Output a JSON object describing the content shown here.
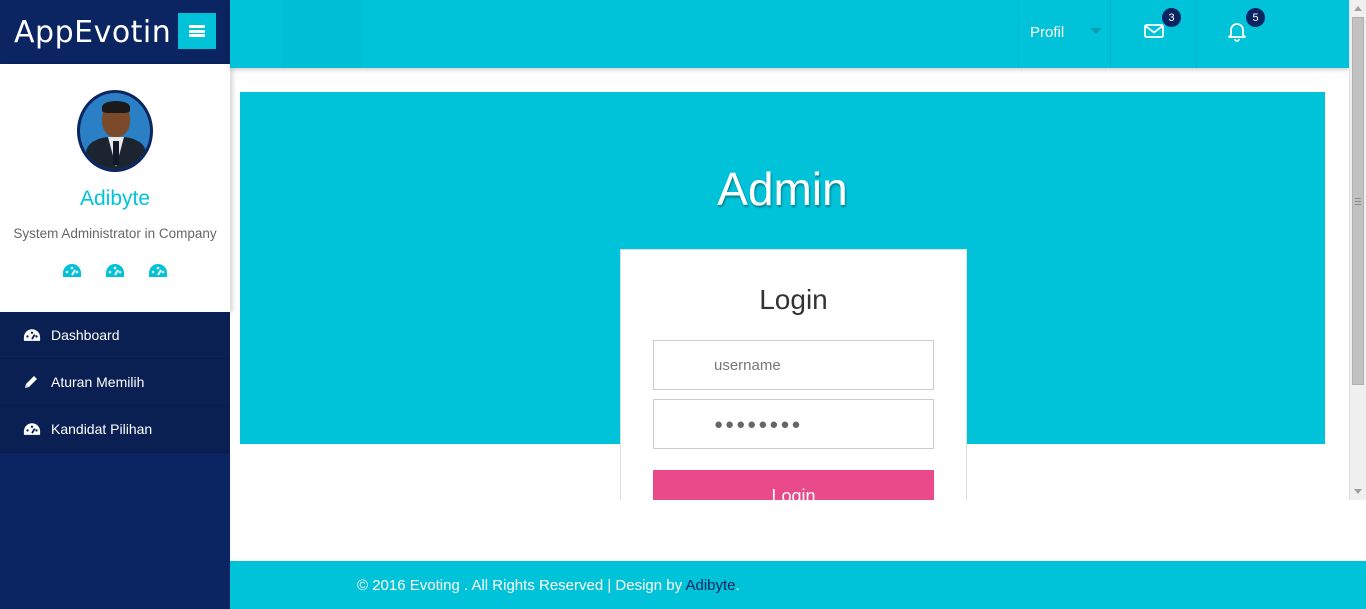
{
  "brand": {
    "title": "AppEvotin",
    "toggle_icon": "menu-bars-icon"
  },
  "profile": {
    "name": "Adibyte",
    "role": "System Administrator in Company",
    "icons": [
      "dashboard-icon",
      "dashboard-icon",
      "dashboard-icon"
    ]
  },
  "nav": {
    "items": [
      {
        "label": "Dashboard",
        "icon": "dashboard-icon"
      },
      {
        "label": "Aturan Memilih",
        "icon": "pencil-icon"
      },
      {
        "label": "Kandidat Pilihan",
        "icon": "dashboard-icon"
      }
    ]
  },
  "topbar": {
    "profil_label": "Profil",
    "messages_count": "3",
    "notifications_count": "5"
  },
  "main": {
    "hero_title": "Admin",
    "login": {
      "title": "Login",
      "username_placeholder": "username",
      "password_value": "●●●●●●●●",
      "button_label": "Login"
    }
  },
  "footer": {
    "text": "© 2016 Evoting . All Rights Reserved | Design by ",
    "link": "Adibyte",
    "suffix": "."
  },
  "colors": {
    "accent": "#00c3d9",
    "navy": "#0a2562",
    "pink": "#eb4a8a"
  }
}
